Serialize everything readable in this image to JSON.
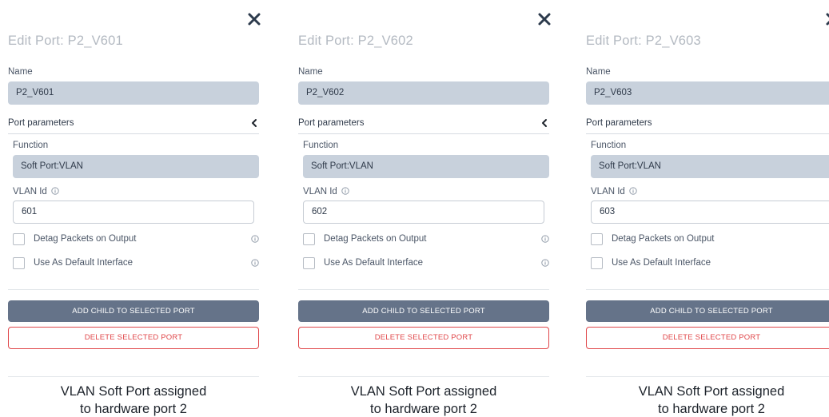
{
  "colors": {
    "field_bg": "#c8d1dc",
    "primary_button": "#657389",
    "danger": "#e0474a",
    "title_text": "#b3b9c1"
  },
  "icons": {
    "close": "close-icon",
    "collapse": "chevron-left-icon",
    "info": "info-icon",
    "checkbox": "checkbox-unchecked"
  },
  "panels": [
    {
      "title": "Edit Port: P2_V601",
      "name_label": "Name",
      "name_value": "P2_V601",
      "section_label": "Port parameters",
      "function_label": "Function",
      "function_value": "Soft Port:VLAN",
      "vlan_label": "VLAN Id",
      "vlan_value": "601",
      "detag_label": "Detag Packets on Output",
      "default_label": "Use As Default Interface",
      "add_button": "ADD CHILD TO SELECTED PORT",
      "delete_button": "DELETE SELECTED PORT",
      "caption_line1": "VLAN Soft Port assigned",
      "caption_line2": "to hardware port 2"
    },
    {
      "title": "Edit Port: P2_V602",
      "name_label": "Name",
      "name_value": "P2_V602",
      "section_label": "Port parameters",
      "function_label": "Function",
      "function_value": "Soft Port:VLAN",
      "vlan_label": "VLAN Id",
      "vlan_value": "602",
      "detag_label": "Detag Packets on Output",
      "default_label": "Use As Default Interface",
      "add_button": "ADD CHILD TO SELECTED PORT",
      "delete_button": "DELETE SELECTED PORT",
      "caption_line1": "VLAN Soft Port assigned",
      "caption_line2": "to hardware port 2"
    },
    {
      "title": "Edit Port: P2_V603",
      "name_label": "Name",
      "name_value": "P2_V603",
      "section_label": "Port parameters",
      "function_label": "Function",
      "function_value": "Soft Port:VLAN",
      "vlan_label": "VLAN Id",
      "vlan_value": "603",
      "detag_label": "Detag Packets on Output",
      "default_label": "Use As Default Interface",
      "add_button": "ADD CHILD TO SELECTED PORT",
      "delete_button": "DELETE SELECTED PORT",
      "caption_line1": "VLAN Soft Port assigned",
      "caption_line2": "to hardware port 2"
    }
  ]
}
